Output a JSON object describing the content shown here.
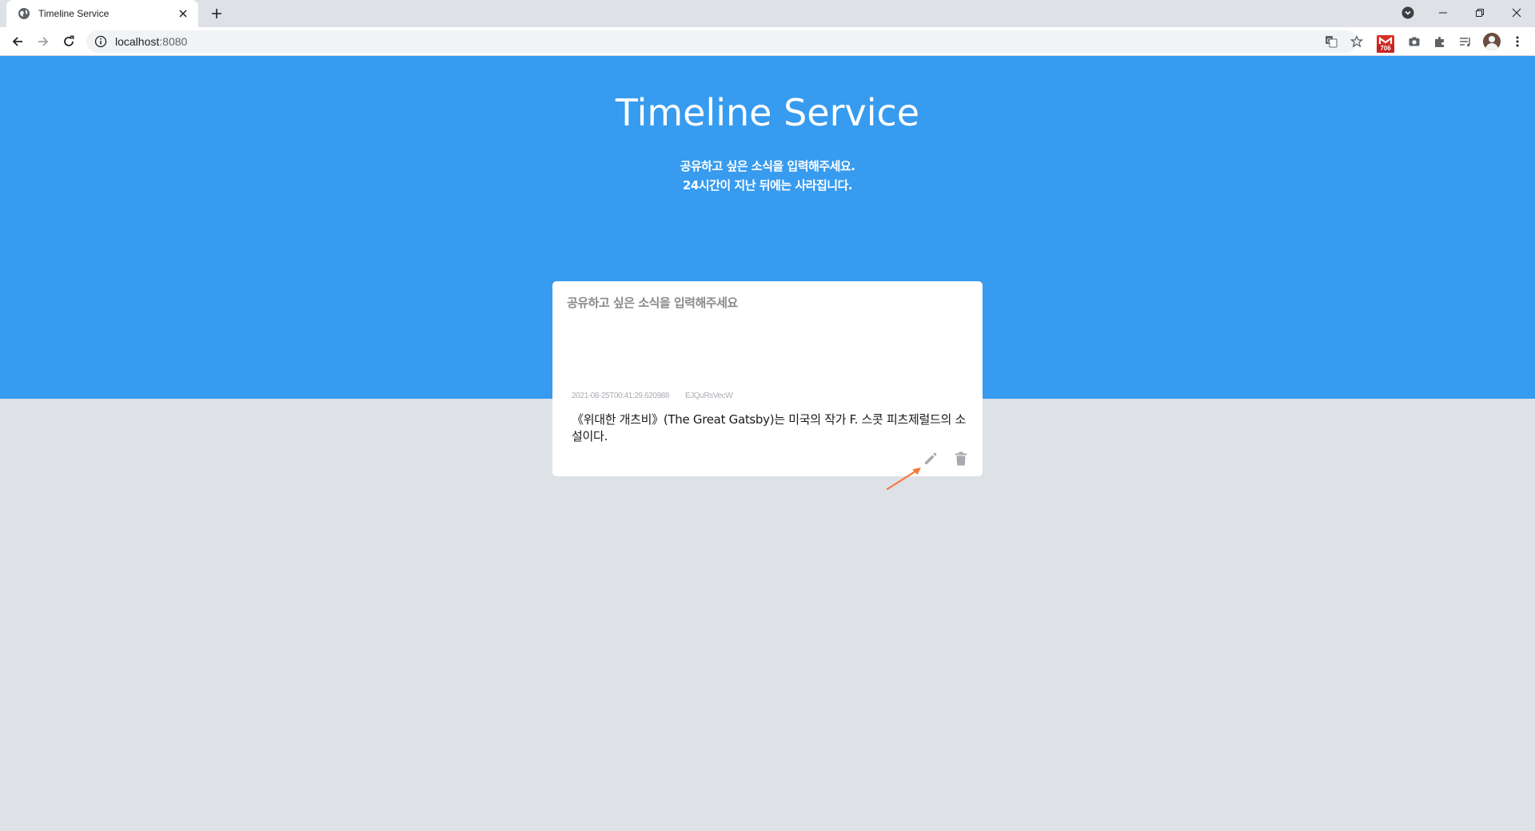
{
  "browser": {
    "tab_title": "Timeline Service",
    "url_host": "localhost",
    "url_port": ":8080",
    "extension_badge": "706"
  },
  "page": {
    "title": "Timeline Service",
    "subtitle_line1": "공유하고 싶은 소식을 입력해주세요.",
    "subtitle_line2": "24시간이 지난 뒤에는 사라집니다.",
    "compose_placeholder": "공유하고 싶은 소식을 입력해주세요"
  },
  "posts": [
    {
      "timestamp": "2021-08-25T00:41:29.620988",
      "user": "EJQuRsVecW",
      "content": "《위대한 개츠비》(The Great Gatsby)는 미국의 작가 F. 스콧 피츠제럴드의 소설이다."
    }
  ],
  "colors": {
    "hero_bg": "#379bef",
    "page_bg": "#dee1e6",
    "annotation_arrow": "#f5793b"
  }
}
